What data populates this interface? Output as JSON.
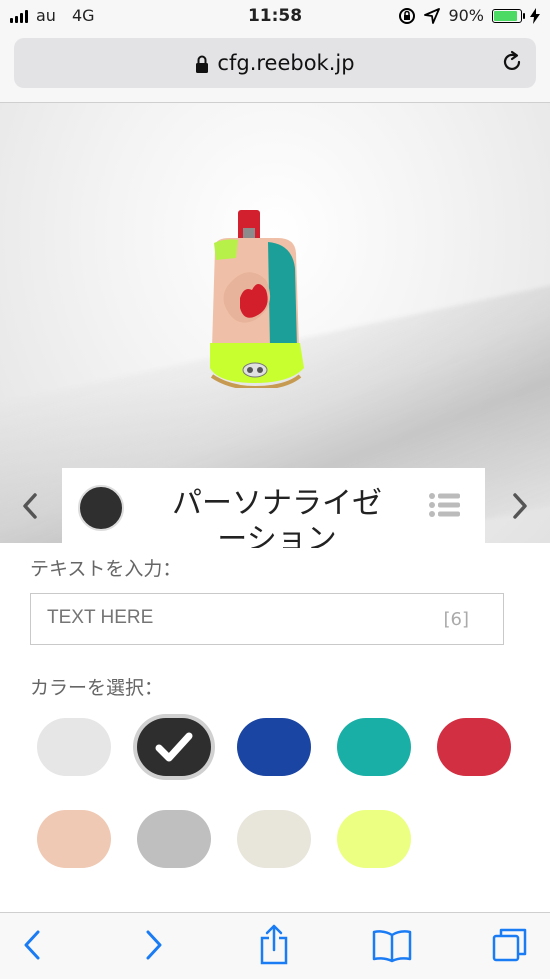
{
  "status": {
    "carrier": "au",
    "network": "4G",
    "time": "11:58",
    "battery": "90%",
    "battery_level": 0.9
  },
  "browser": {
    "url": "cfg.reebok.jp"
  },
  "customizer": {
    "section_title": "パーソナライゼーション",
    "text_label": "テキストを入力：",
    "text_placeholder": "TEXT HERE",
    "char_count": "[6]",
    "color_label": "カラーを選択："
  },
  "colors": {
    "swatches": [
      {
        "name": "light-gray",
        "hex": "#e6e6e6",
        "selected": false
      },
      {
        "name": "black",
        "hex": "#2e2e2e",
        "selected": true
      },
      {
        "name": "blue",
        "hex": "#1b45a3",
        "selected": false
      },
      {
        "name": "teal",
        "hex": "#1aafa6",
        "selected": false
      },
      {
        "name": "red",
        "hex": "#d22f43",
        "selected": false
      },
      {
        "name": "peach",
        "hex": "#efc9b3",
        "selected": false
      },
      {
        "name": "gray",
        "hex": "#bfbfbf",
        "selected": false
      },
      {
        "name": "off-white",
        "hex": "#e8e5db",
        "selected": false
      },
      {
        "name": "lime",
        "hex": "#ecff82",
        "selected": false
      }
    ],
    "ios_blue": "#1a7cf5"
  },
  "icons": [
    "signal-icon",
    "rotation-lock-icon",
    "location-icon",
    "battery-icon",
    "charging-icon",
    "lock-icon",
    "reload-icon",
    "chevron-left-icon",
    "chevron-right-icon",
    "list-icon",
    "check-icon",
    "back-icon",
    "forward-icon",
    "share-icon",
    "bookmarks-icon",
    "tabs-icon"
  ]
}
